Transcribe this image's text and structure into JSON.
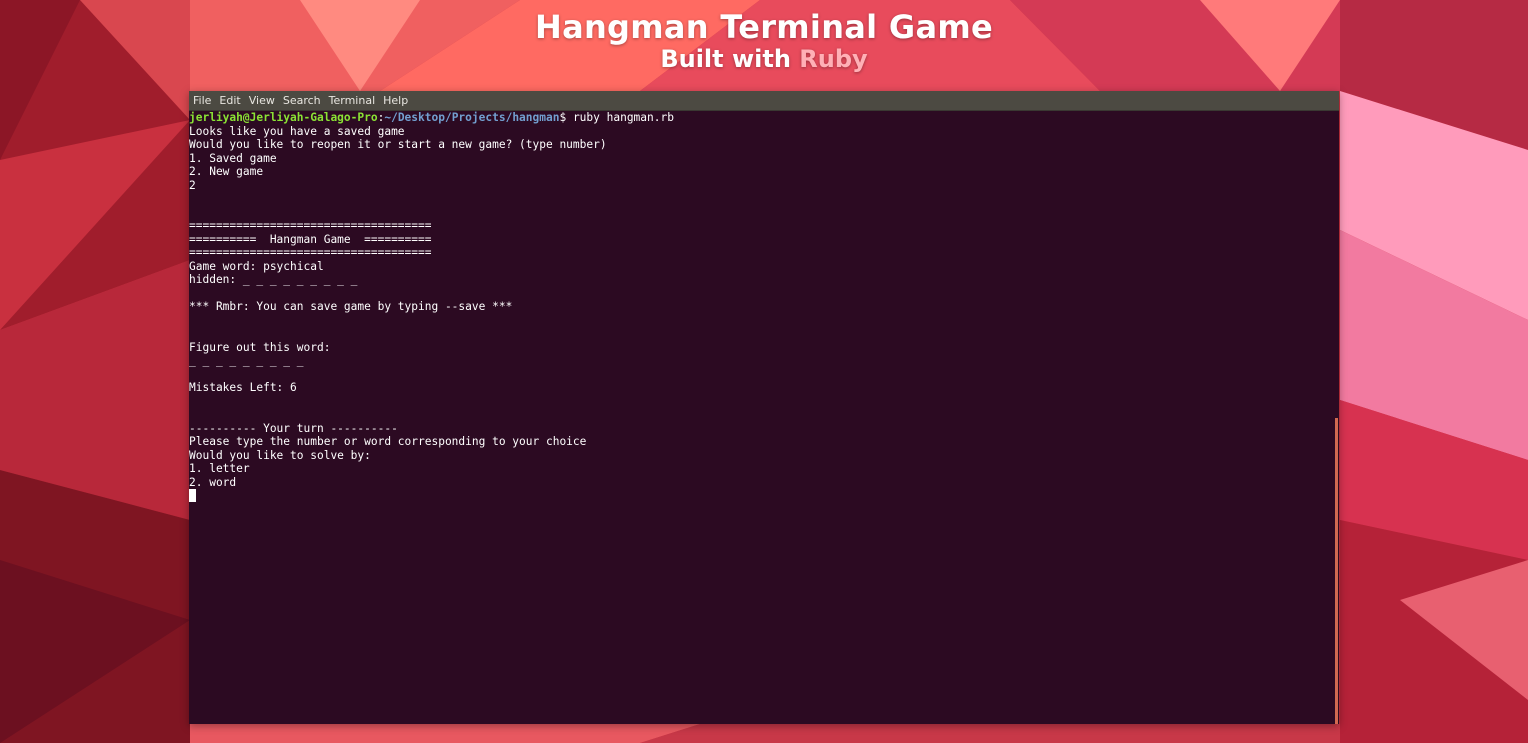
{
  "header": {
    "title": "Hangman Terminal Game",
    "subtitle_prefix": "Built with ",
    "subtitle_accent": "Ruby"
  },
  "terminal": {
    "menu": [
      "File",
      "Edit",
      "View",
      "Search",
      "Terminal",
      "Help"
    ],
    "prompt": {
      "user": "jerliyah@Jerliyah-Galago-Pro",
      "sep": ":",
      "path": "~/Desktop/Projects/hangman",
      "command": "$ ruby hangman.rb"
    },
    "lines": [
      "Looks like you have a saved game",
      "Would you like to reopen it or start a new game? (type number)",
      "1. Saved game",
      "2. New game",
      "2",
      "",
      "",
      "====================================",
      "==========  Hangman Game  ==========",
      "====================================",
      "Game word: psychical",
      "hidden: _ _ _ _ _ _ _ _ _",
      "",
      "*** Rmbr: You can save game by typing --save ***",
      "",
      "",
      "Figure out this word:",
      "_ _ _ _ _ _ _ _ _",
      "",
      "Mistakes Left: 6",
      "",
      "",
      "---------- Your turn ----------",
      "Please type the number or word corresponding to your choice",
      "Would you like to solve by:",
      "1. letter",
      "2. word"
    ]
  },
  "colors": {
    "terminal_bg": "#2c0a22",
    "menubar_bg": "#4c4a42",
    "prompt_user": "#8ae234",
    "prompt_path": "#729fcf",
    "accent": "#ffb0b6"
  }
}
